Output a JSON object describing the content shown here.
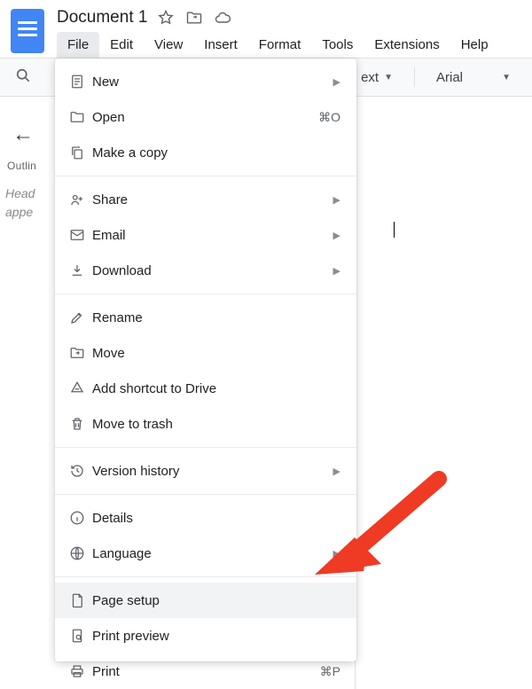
{
  "title": {
    "doc_name": "Document 1"
  },
  "menubar": {
    "file": "File",
    "edit": "Edit",
    "view": "View",
    "insert": "Insert",
    "format": "Format",
    "tools": "Tools",
    "extensions": "Extensions",
    "help": "Help"
  },
  "toolbar": {
    "styles_trail": "ext",
    "font": "Arial"
  },
  "outline": {
    "label": "Outlin",
    "placeholder_line1": "Head",
    "placeholder_line2": "appe"
  },
  "file_menu": {
    "new": "New",
    "open": "Open",
    "open_shortcut": "⌘O",
    "make_copy": "Make a copy",
    "share": "Share",
    "email": "Email",
    "download": "Download",
    "rename": "Rename",
    "move": "Move",
    "add_shortcut": "Add shortcut to Drive",
    "move_trash": "Move to trash",
    "version_history": "Version history",
    "details": "Details",
    "language": "Language",
    "page_setup": "Page setup",
    "print_preview": "Print preview",
    "print": "Print",
    "print_shortcut": "⌘P"
  }
}
